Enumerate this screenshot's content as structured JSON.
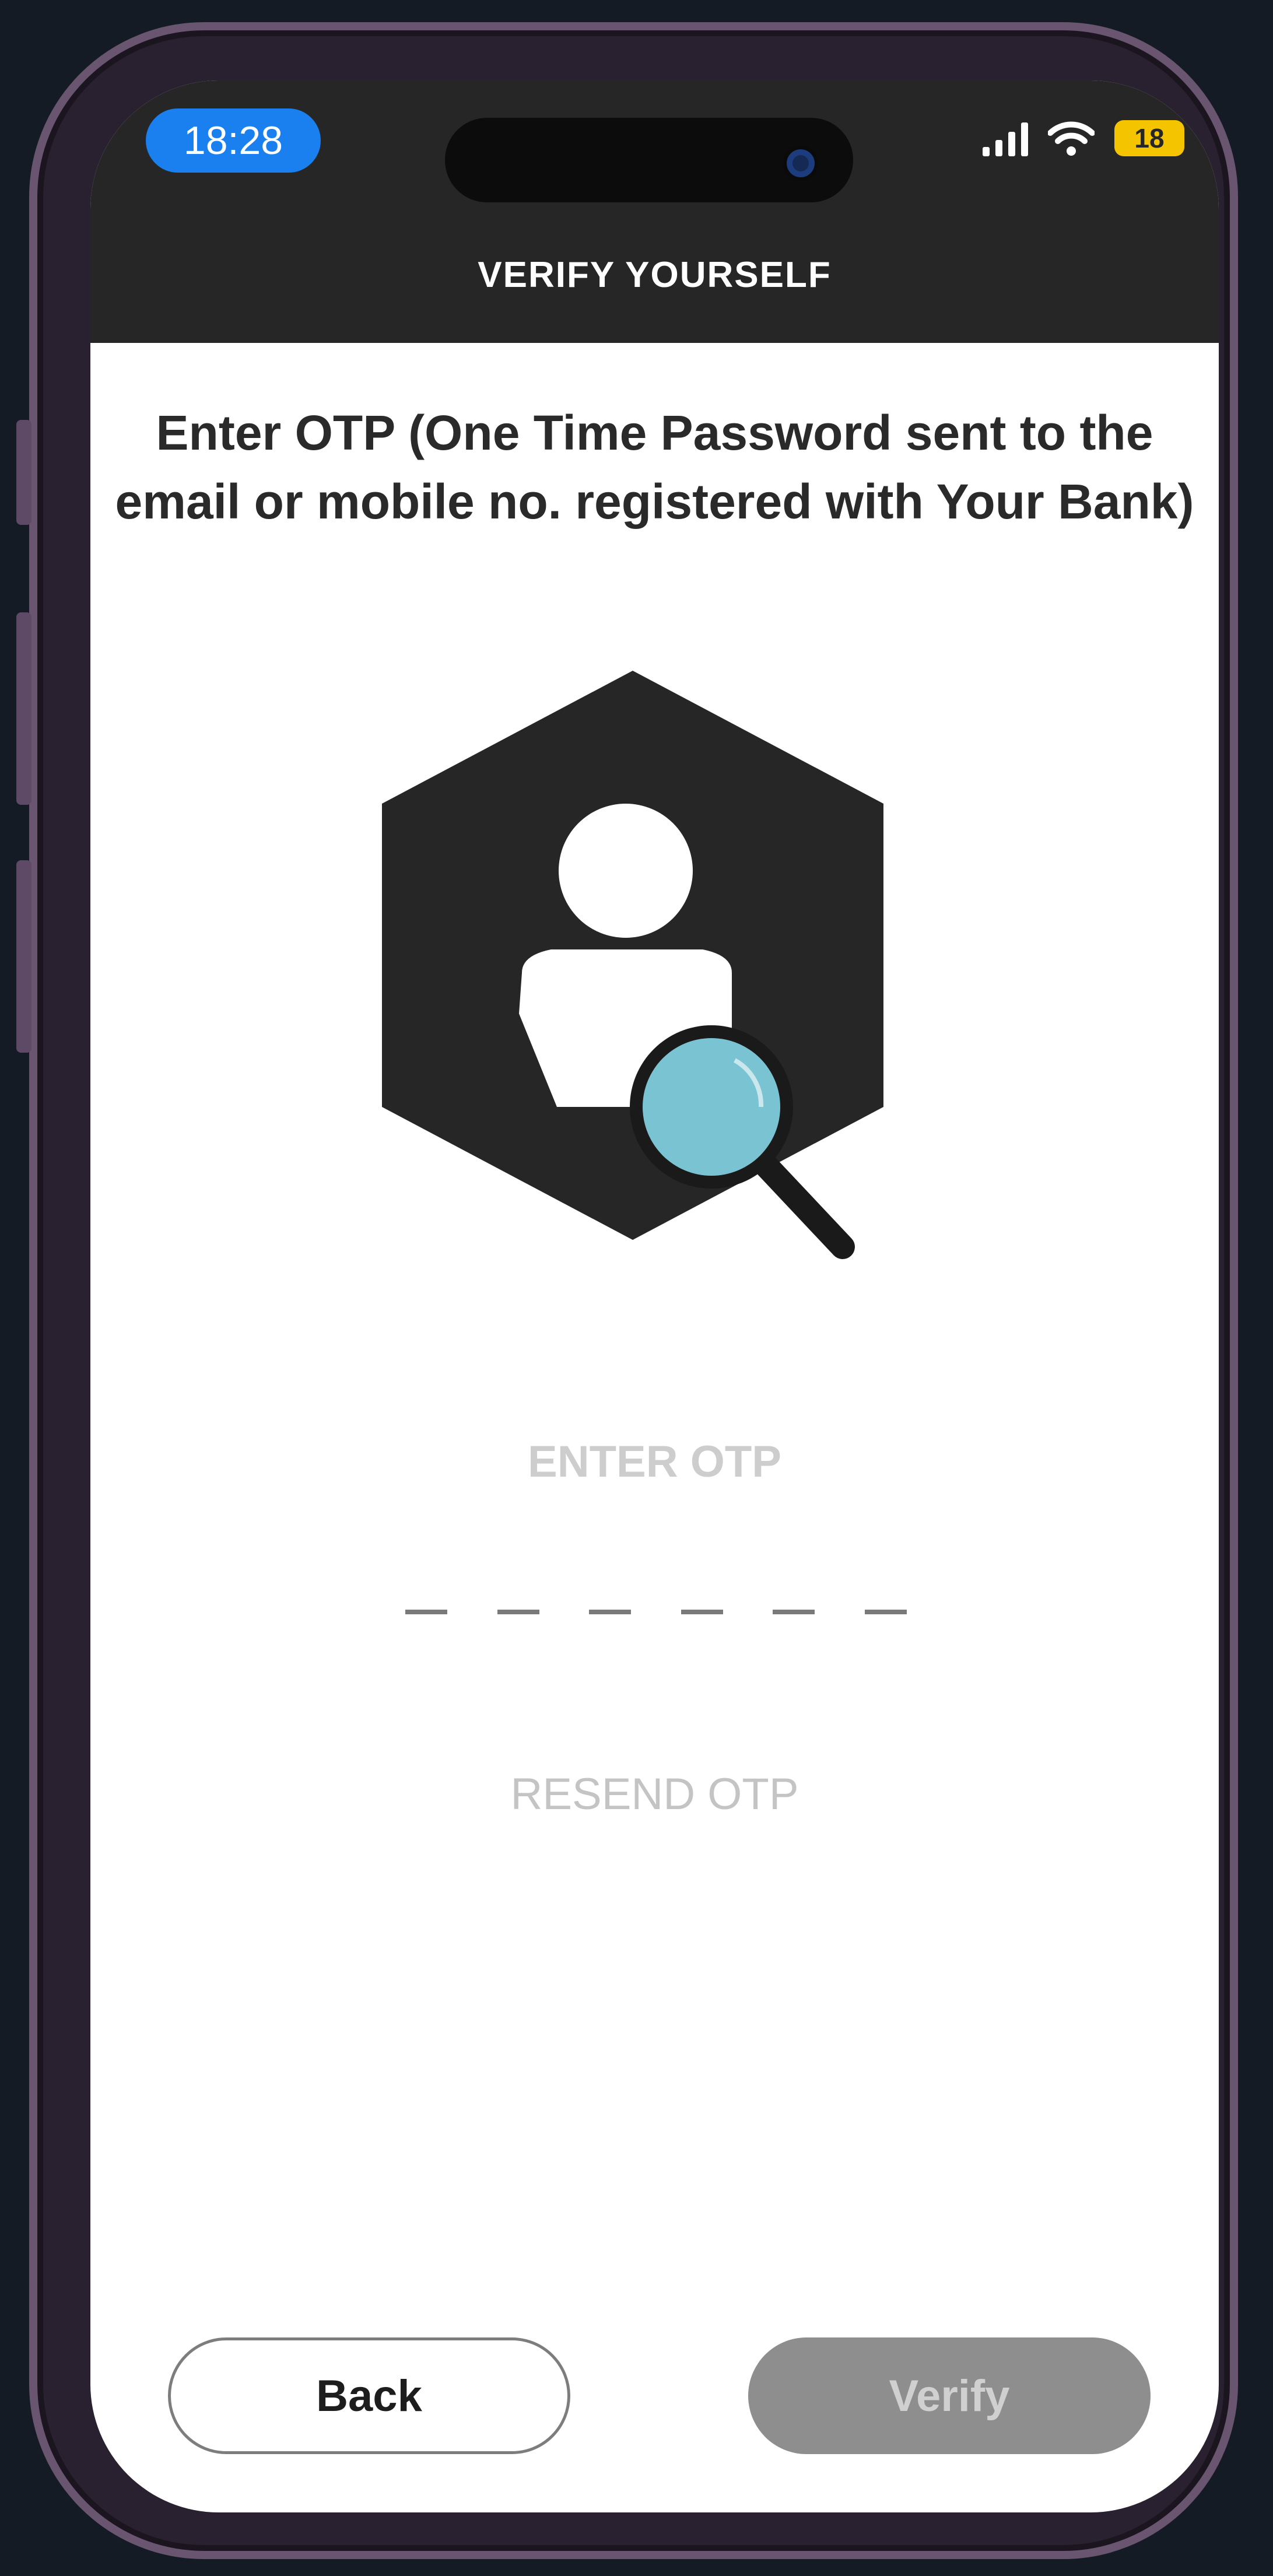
{
  "status_bar": {
    "time": "18:28",
    "battery": "18"
  },
  "header": {
    "title": "VERIFY YOURSELF"
  },
  "instruction": "Enter OTP (One Time Password sent to the email or mobile no. registered with Your Bank)",
  "otp": {
    "label": "ENTER OTP",
    "digit_slots": 6
  },
  "resend_label": "RESEND OTP",
  "buttons": {
    "back": "Back",
    "verify": "Verify"
  },
  "colors": {
    "header_bg": "#262626",
    "time_pill": "#1a80f0",
    "battery": "#f4c400",
    "hexagon": "#262626",
    "magnifier_lens": "#7ac3d3",
    "verify_button_disabled": "#8e8e8e"
  },
  "icons": [
    "signal-icon",
    "wifi-icon",
    "battery-icon",
    "user-search-icon"
  ]
}
